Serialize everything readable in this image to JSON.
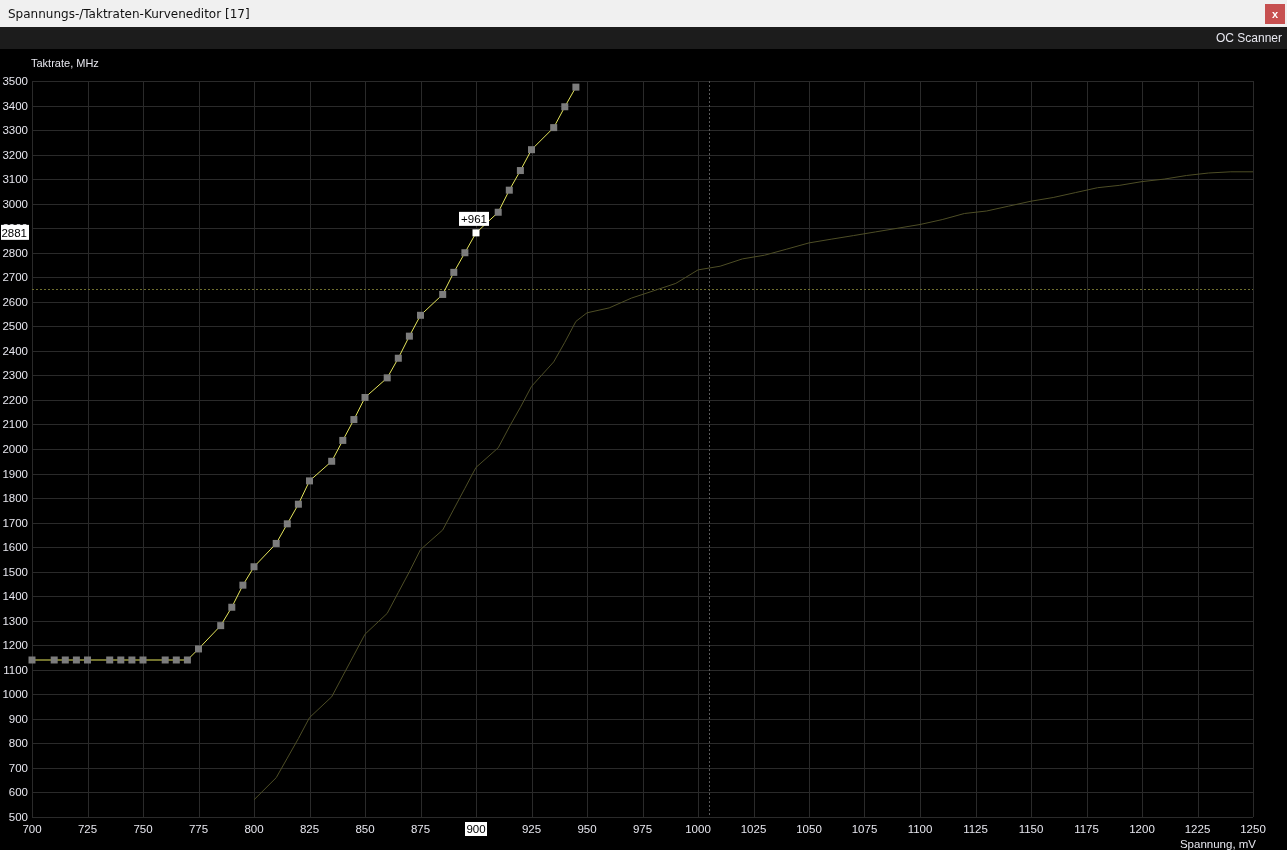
{
  "window": {
    "title": "Spannungs-/Taktraten-Kurveneditor [17]",
    "close": "x"
  },
  "toolbar": {
    "button": "OC Scanner"
  },
  "chart": {
    "chart_data": {
      "type": "line",
      "xlabel": "Spannung, mV",
      "ylabel": "Taktrate, MHz",
      "x": [
        700,
        710,
        715,
        720,
        725,
        735,
        740,
        745,
        750,
        760,
        765,
        770,
        775,
        785,
        790,
        795,
        800,
        810,
        815,
        820,
        825,
        835,
        840,
        845,
        850,
        860,
        865,
        870,
        875,
        885,
        890,
        895,
        900,
        910,
        915,
        920,
        925,
        935,
        940,
        945,
        950,
        960,
        970,
        980,
        990,
        1000,
        1010,
        1020,
        1030,
        1040,
        1050,
        1060,
        1070,
        1080,
        1090,
        1100,
        1110,
        1120,
        1130,
        1140,
        1150,
        1160,
        1170,
        1180,
        1190,
        1200,
        1210,
        1220,
        1230,
        1240,
        1250
      ],
      "series": [
        {
          "color": "#e6e65c",
          "marker": "square",
          "values": [
            1140,
            1140,
            1140,
            1140,
            1140,
            1140,
            1140,
            1140,
            1140,
            1140,
            1140,
            1140,
            1185,
            1280,
            1355,
            1445,
            1520,
            1615,
            1695,
            1775,
            1870,
            1950,
            2035,
            2120,
            2210,
            2290,
            2370,
            2460,
            2545,
            2630,
            2720,
            2800,
            2881,
            2965,
            3055,
            3135,
            3220,
            3310,
            3395,
            3475,
            null,
            null,
            null,
            null,
            null,
            null,
            null,
            null,
            null,
            null,
            null,
            null,
            null,
            null,
            null,
            null,
            null,
            null,
            null,
            null,
            null,
            null,
            null,
            null,
            null,
            null,
            null,
            null,
            null,
            null,
            null
          ]
        },
        {
          "color": "#4e4e26",
          "values": [
            null,
            null,
            null,
            null,
            null,
            null,
            null,
            null,
            null,
            null,
            null,
            null,
            null,
            null,
            null,
            null,
            570,
            660,
            740,
            820,
            905,
            990,
            1075,
            1160,
            1245,
            1330,
            1415,
            1500,
            1590,
            1670,
            1755,
            1840,
            1925,
            2005,
            2090,
            2170,
            2255,
            2355,
            2435,
            2520,
            2555,
            2575,
            2615,
            2645,
            2675,
            2730,
            2745,
            2775,
            2790,
            2815,
            2840,
            2855,
            2870,
            2885,
            2900,
            2915,
            2935,
            2960,
            2970,
            2990,
            3010,
            3025,
            3045,
            3065,
            3075,
            3090,
            3100,
            3115,
            3125,
            3130,
            3130
          ]
        }
      ],
      "xlim": [
        700,
        1250
      ],
      "ylim": [
        500,
        3500
      ],
      "xticks": [
        700,
        725,
        750,
        775,
        800,
        825,
        850,
        875,
        900,
        925,
        950,
        975,
        1000,
        1025,
        1050,
        1075,
        1100,
        1125,
        1150,
        1175,
        1200,
        1225,
        1250
      ],
      "yticks": [
        500,
        600,
        700,
        800,
        900,
        1000,
        1100,
        1200,
        1300,
        1400,
        1500,
        1600,
        1700,
        1800,
        1900,
        2000,
        2100,
        2200,
        2300,
        2400,
        2500,
        2600,
        2700,
        2800,
        2900,
        3000,
        3100,
        3200,
        3300,
        3400,
        3500
      ],
      "grid": true,
      "ref_lines": [
        {
          "axis": "x",
          "value": 1005,
          "color": "#5a5a5a"
        },
        {
          "axis": "y",
          "value": 2652,
          "color": "#6e6e2e"
        }
      ],
      "annotations": [
        {
          "x": 900,
          "y": 2881,
          "text": "+961"
        }
      ]
    },
    "cursor": {
      "y_label": "2881"
    }
  }
}
